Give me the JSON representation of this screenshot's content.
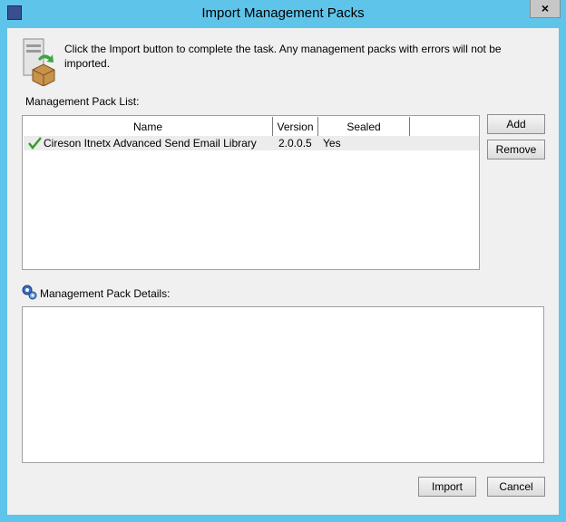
{
  "window": {
    "title": "Import Management Packs",
    "close_label": "×"
  },
  "instructions": "Click the Import button to complete the task. Any management packs with errors will not be imported.",
  "list_section": {
    "label": "Management Pack List:",
    "columns": [
      "Name",
      "Version",
      "Sealed",
      ""
    ],
    "rows": [
      {
        "name": "Cireson Itnetx Advanced Send Email Library",
        "version": "2.0.0.5",
        "sealed": "Yes",
        "status_icon": "checkmark-icon"
      }
    ]
  },
  "side_buttons": {
    "add": "Add",
    "remove": "Remove"
  },
  "details_section": {
    "label": "Management Pack Details:"
  },
  "footer": {
    "import": "Import",
    "cancel": "Cancel"
  },
  "colors": {
    "frame": "#5ec4ea",
    "client": "#f0f0f0",
    "check": "#3a9b2e"
  }
}
